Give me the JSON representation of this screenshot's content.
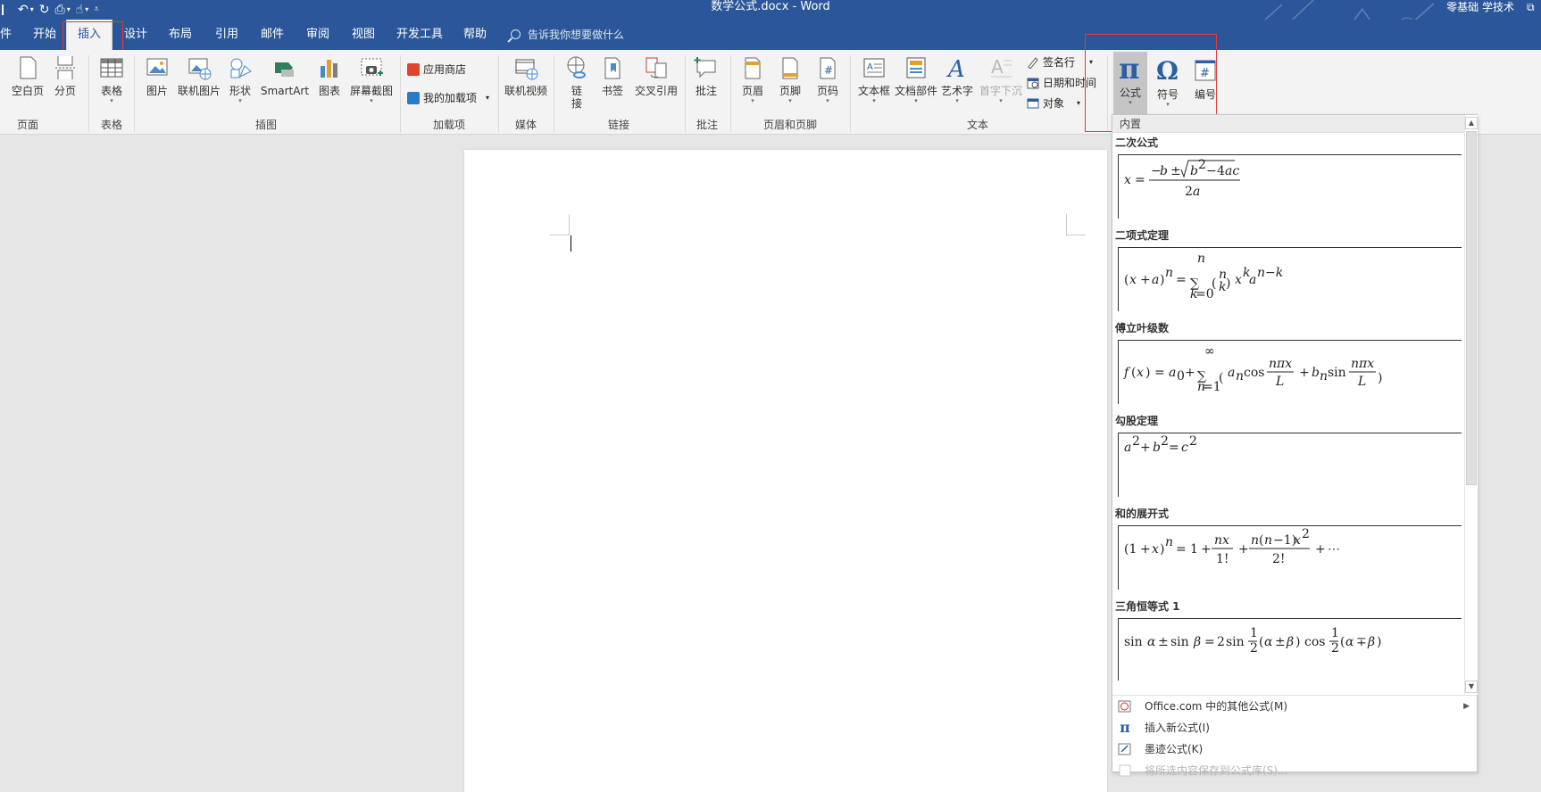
{
  "app": {
    "doc_title": "数学公式.docx  -  Word",
    "user": "零基础 学技术"
  },
  "tabs": [
    {
      "label": "件"
    },
    {
      "label": "开始"
    },
    {
      "label": "插入"
    },
    {
      "label": "设计"
    },
    {
      "label": "布局"
    },
    {
      "label": "引用"
    },
    {
      "label": "邮件"
    },
    {
      "label": "审阅"
    },
    {
      "label": "视图"
    },
    {
      "label": "开发工具"
    },
    {
      "label": "帮助"
    }
  ],
  "tell_me": "告诉我你想要做什么",
  "ribbon": {
    "pages": {
      "blank": "空白页",
      "break": "分页",
      "group": "页面"
    },
    "tables": {
      "table": "表格",
      "group": "表格"
    },
    "illustrations": {
      "picture": "图片",
      "online_picture": "联机图片",
      "shapes": "形状",
      "smartart": "SmartArt",
      "chart": "图表",
      "screenshot": "屏幕截图",
      "group": "插图"
    },
    "addins": {
      "store": "应用商店",
      "my_addins": "我的加载项",
      "group": "加载项"
    },
    "media": {
      "online_video": "联机视频",
      "group": "媒体"
    },
    "links": {
      "link_1": "链",
      "link_2": "接",
      "bookmark": "书签",
      "cross_ref": "交叉引用",
      "group": "链接"
    },
    "comments": {
      "comment": "批注",
      "group": "批注"
    },
    "header_footer": {
      "header": "页眉",
      "footer": "页脚",
      "page_number": "页码",
      "group": "页眉和页脚"
    },
    "text": {
      "textbox": "文本框",
      "quick_parts": "文档部件",
      "wordart": "艺术字",
      "dropcap": "首字下沉",
      "signature": "签名行",
      "datetime": "日期和时间",
      "object": "对象",
      "group": "文本"
    },
    "symbols": {
      "equation": "公式",
      "symbol": "符号",
      "numbering": "编号"
    }
  },
  "gallery": {
    "header": "内置",
    "items": [
      {
        "title": "二次公式"
      },
      {
        "title": "二项式定理"
      },
      {
        "title": "傅立叶级数"
      },
      {
        "title": "勾股定理"
      },
      {
        "title": "和的展开式"
      },
      {
        "title": "三角恒等式 1"
      }
    ],
    "footer": [
      {
        "label": "Office.com 中的其他公式(M)"
      },
      {
        "label": "插入新公式(I)"
      },
      {
        "label": "墨迹公式(K)"
      },
      {
        "label": "将所选内容保存到公式库(S)..."
      }
    ]
  },
  "colors": {
    "title_bar": "#2b579a",
    "ribbon_bg": "#f3f3f3",
    "highlight_box": "#e23b3b",
    "canvas_bg": "#e6e6e6"
  }
}
